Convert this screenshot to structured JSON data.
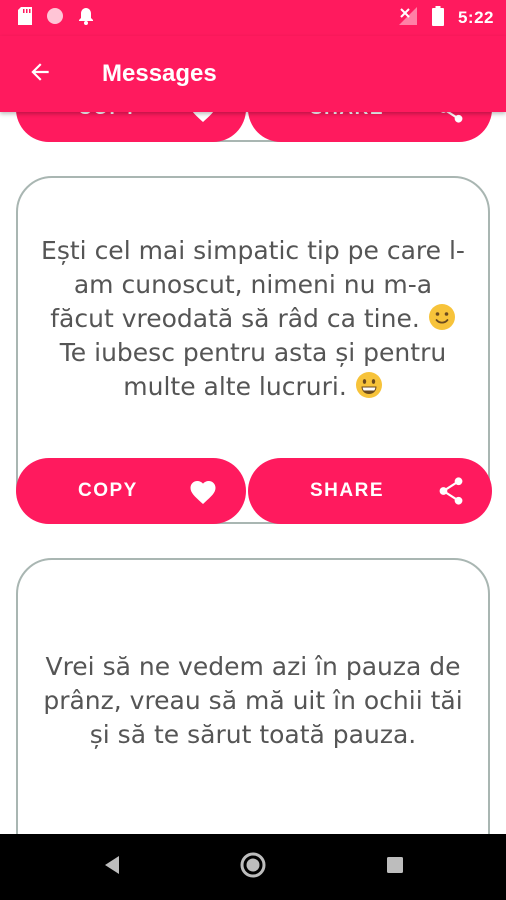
{
  "status_bar": {
    "time": "5:22",
    "icons_left": [
      "sd-card-icon",
      "notification-dot-icon",
      "bell-icon"
    ],
    "icons_right": [
      "signal-off-icon",
      "battery-icon"
    ]
  },
  "app_bar": {
    "title": "Messages",
    "back_icon": "arrow-left-icon"
  },
  "theme": {
    "accent": "#ff1a5e",
    "card_border": "#a9b6b2",
    "text": "#555555"
  },
  "messages": [
    {
      "text_part1": "",
      "copy_label": "COPY",
      "share_label": "SHARE"
    },
    {
      "text_part1": "Ești cel mai simpatic tip pe care l-am cunoscut, nimeni nu m-a făcut vreodată să râd ca tine. ",
      "emoji1": "slightly-smiling-face",
      "text_part2": " Te iubesc pentru asta și pentru multe alte lucruri. ",
      "emoji2": "grinning-face",
      "copy_label": "COPY",
      "share_label": "SHARE"
    },
    {
      "text_part1": "Vrei să ne vedem azi în pauza de prânz, vreau să mă uit în ochii tăi și să te sărut toată pauza."
    }
  ],
  "nav_bar": {
    "buttons": [
      "back-triangle-icon",
      "home-circle-icon",
      "recents-square-icon"
    ]
  }
}
